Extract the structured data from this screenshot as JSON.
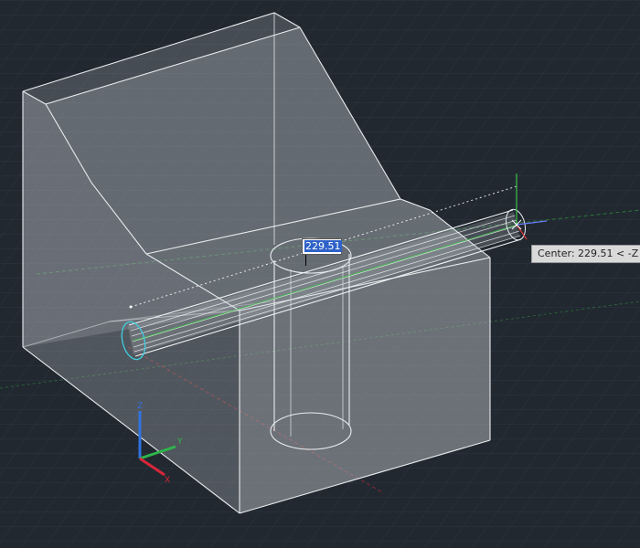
{
  "viewport": {
    "background": "#212830",
    "grid_color": "#2e3743",
    "wireframe_color": "#e8ecef",
    "solid_fill": "#a8adb3"
  },
  "dynamic_input": {
    "value": "229.51"
  },
  "tooltip": {
    "text": "Center: 229.51 < -Z"
  },
  "ucs_icon": {
    "x_label": "X",
    "y_label": "Y",
    "z_label": "Z",
    "x_color": "#d8263a",
    "y_color": "#2fb54a",
    "z_color": "#2f73e0"
  }
}
